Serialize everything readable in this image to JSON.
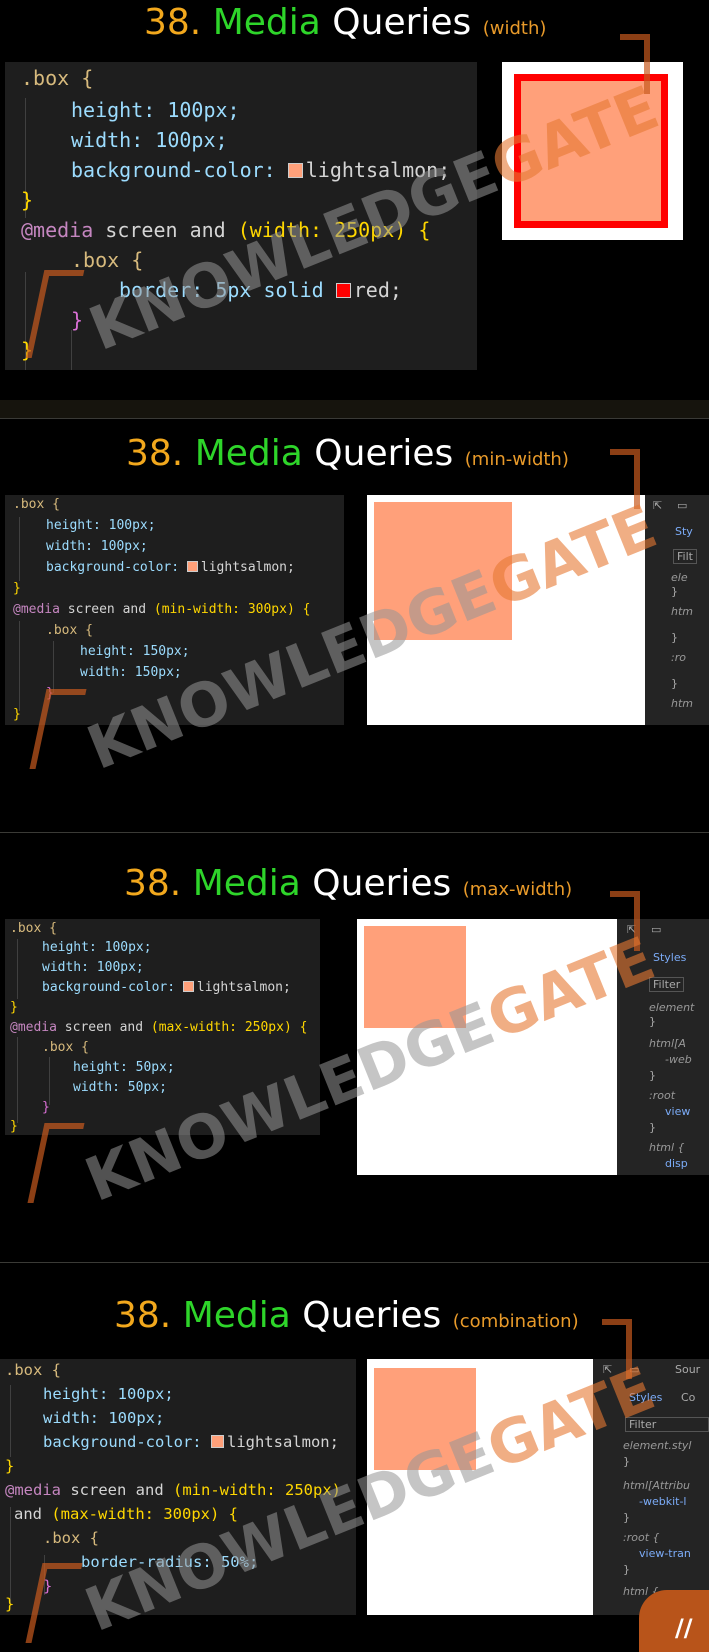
{
  "panels": [
    {
      "title": {
        "number": "38.",
        "media": "Media",
        "queries": "Queries",
        "subtitle": "(width)"
      },
      "code": [
        ".box {",
        "height: 100px;",
        "width: 100px;",
        "background-color:",
        "lightsalmon;",
        "}",
        "@media",
        "screen and",
        "(width: 250px)",
        "{",
        ".box {",
        "border: 5px solid",
        "red;",
        "}",
        "}"
      ]
    },
    {
      "title": {
        "number": "38.",
        "media": "Media",
        "queries": "Queries",
        "subtitle": "(min-width)"
      },
      "code": [
        ".box {",
        "height: 100px;",
        "width: 100px;",
        "background-color:",
        "lightsalmon;",
        "}",
        "@media",
        "screen and",
        "(min-width: 300px)",
        "{",
        ".box {",
        "height: 150px;",
        "width: 150px;",
        "}",
        "}"
      ]
    },
    {
      "title": {
        "number": "38.",
        "media": "Media",
        "queries": "Queries",
        "subtitle": "(max-width)"
      },
      "code": [
        ".box {",
        "height: 100px;",
        "width: 100px;",
        "background-color:",
        "lightsalmon;",
        "}",
        "@media",
        "screen and",
        "(max-width: 250px)",
        "{",
        ".box {",
        "height: 50px;",
        "width: 50px;",
        "}",
        "}"
      ]
    },
    {
      "title": {
        "number": "38.",
        "media": "Media",
        "queries": "Queries",
        "subtitle": "(combination)"
      },
      "code": [
        ".box {",
        "height: 100px;",
        "width: 100px;",
        "background-color:",
        "lightsalmon;",
        "}",
        "@media",
        "screen and",
        "(min-width: 250px)",
        "and",
        "(max-width: 300px)",
        "{",
        ".box {",
        "border-radius: 50%;",
        "}",
        "}"
      ]
    }
  ],
  "devtools": {
    "p2": [
      "Sty",
      "Filt",
      "ele",
      "}",
      "htm",
      "}",
      ":ro",
      "}",
      "htm"
    ],
    "p3": [
      "Styles",
      "Filter",
      "element",
      "}",
      "html[A",
      "-web",
      "}",
      ":root",
      "view",
      "}",
      "html {",
      "disp"
    ],
    "p4": [
      "Sour",
      "Styles",
      "Co",
      "Filter",
      "element.styl",
      "}",
      "html[Attribu",
      "-webkit-l",
      "}",
      ":root {",
      "view-tran",
      "}",
      "html {"
    ]
  },
  "watermark": {
    "part1": "KNOWLEDGE",
    "part2": "GATE"
  },
  "colors": {
    "salmon": "#ffa07a",
    "red": "#ff0000",
    "accent": "#f2a81d",
    "green": "#2ed52a"
  },
  "icons": [
    "inspect-icon",
    "device-toolbar-icon",
    "expand-arrow-icon",
    "corner-logo-icon"
  ]
}
